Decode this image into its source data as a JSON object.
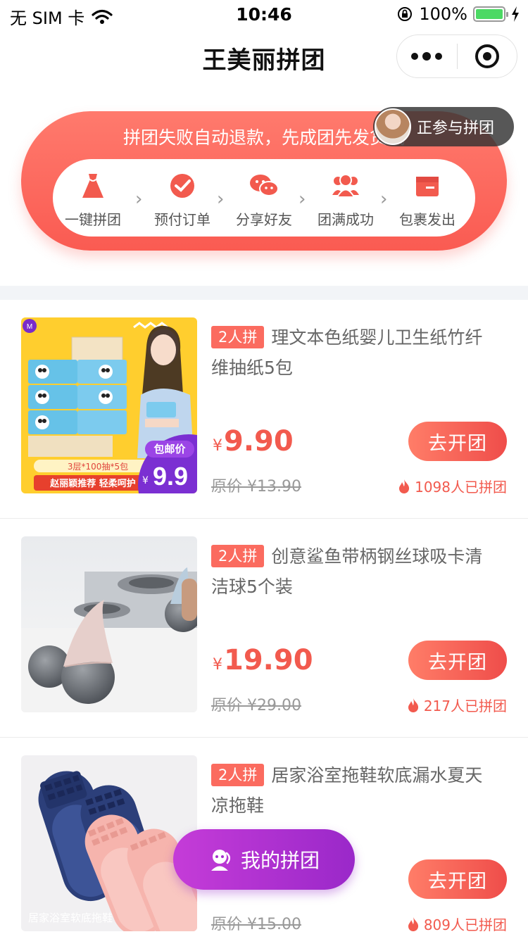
{
  "status_bar": {
    "carrier": "无 SIM 卡",
    "time": "10:46",
    "battery": "100%"
  },
  "nav": {
    "title": "王美丽拼团"
  },
  "banner": {
    "text": "拼团失败自动退款，先成团先发货哦",
    "steps": [
      {
        "label": "一键拼团",
        "icon": "dress-icon"
      },
      {
        "label": "预付订单",
        "icon": "check-badge-icon"
      },
      {
        "label": "分享好友",
        "icon": "wechat-icon"
      },
      {
        "label": "团满成功",
        "icon": "group-icon"
      },
      {
        "label": "包裹发出",
        "icon": "package-icon"
      }
    ],
    "join_text": "正参与拼团"
  },
  "products": [
    {
      "tag": "2人拼",
      "title": "理文本色纸婴儿卫生纸竹纤维抽纸5包",
      "price": "9.90",
      "currency": "¥",
      "original": "原价 ¥13.90",
      "button": "去开团",
      "sold": "1098人已拼团",
      "image": {
        "badge": "包邮价",
        "badge_price": "9.9",
        "badge_currency": "¥",
        "spec": "3层*100抽*5包",
        "slogan": "赵丽颖推荐 轻柔呵护"
      }
    },
    {
      "tag": "2人拼",
      "title": "创意鲨鱼带柄钢丝球吸卡清洁球5个装",
      "price": "19.90",
      "currency": "¥",
      "original": "原价 ¥29.00",
      "button": "去开团",
      "sold": "217人已拼团"
    },
    {
      "tag": "2人拼",
      "title": "居家浴室拖鞋软底漏水夏天凉拖鞋",
      "price": "",
      "currency": "",
      "original": "原价 ¥15.00",
      "button": "去开团",
      "sold": "809人已拼团",
      "image": {
        "caption": "居家浴室软底拖鞋"
      }
    }
  ],
  "float_button": {
    "label": "我的拼团"
  },
  "colors": {
    "primary": "#fa5b52",
    "purple": "#b133d1",
    "tag": "#fb6b5f"
  }
}
